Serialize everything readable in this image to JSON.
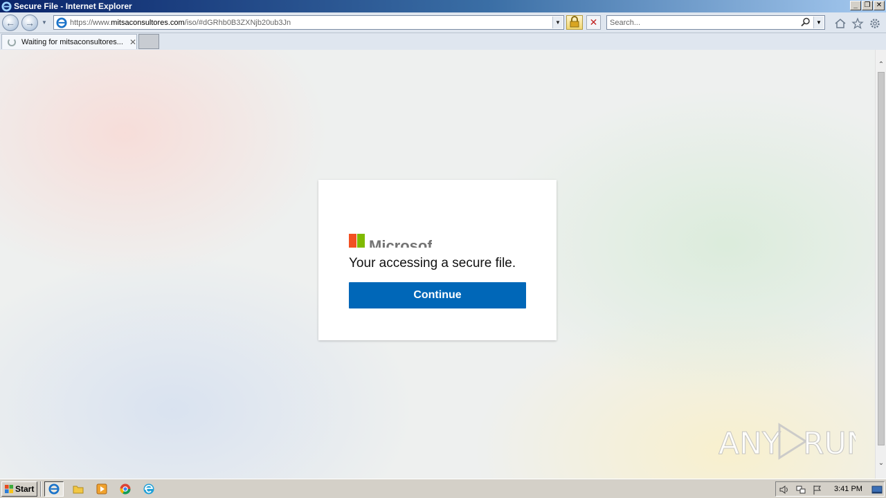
{
  "window": {
    "title": "Secure File - Internet Explorer",
    "controls": {
      "minimize": "_",
      "restore": "❐",
      "close": "✕"
    }
  },
  "navbar": {
    "back_icon": "back-arrow-icon",
    "forward_icon": "forward-arrow-icon",
    "url_scheme": "https://www.",
    "url_domain": "mitsaconsultores.com",
    "url_path": "/iso/#dGRhb0B3ZXNjb20ub3Jn",
    "search_placeholder": "Search..."
  },
  "tabs": [
    {
      "label": "Waiting for mitsaconsultores...",
      "close": "✕"
    }
  ],
  "page": {
    "logo_text": "Microsoft",
    "message": "Your accessing a secure file.",
    "button_label": "Continue",
    "watermark": "ANY RUN",
    "colors": {
      "button": "#0067b8",
      "logo_red": "#f25022",
      "logo_green": "#7fba00"
    }
  },
  "taskbar": {
    "start_label": "Start",
    "apps": [
      "internet-explorer",
      "file-explorer",
      "media-player",
      "chrome",
      "edge"
    ],
    "clock": "3:41 PM"
  }
}
